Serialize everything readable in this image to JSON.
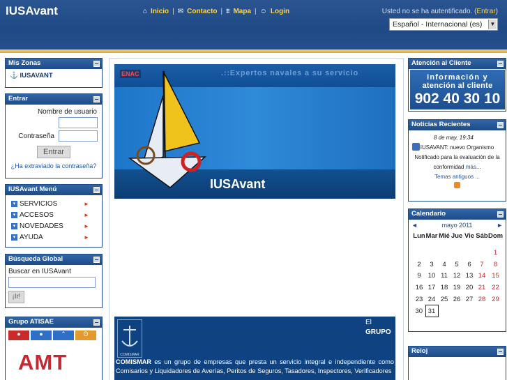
{
  "header": {
    "site_title": "IUSAvant",
    "nav": [
      {
        "icon": "home-icon",
        "label": "Inicio"
      },
      {
        "icon": "mail-icon",
        "label": "Contacto"
      },
      {
        "icon": "sitemap-icon",
        "label": "Mapa"
      },
      {
        "icon": "users-icon",
        "label": "Login"
      }
    ],
    "auth_text": "Usted no se ha autentificado. (",
    "auth_link": "Entrar",
    "auth_close": ")",
    "language": "Español - Internacional (es)"
  },
  "zonas": {
    "title": "Mis Zonas",
    "item": "IUSAVANT"
  },
  "login": {
    "title": "Entrar",
    "username_label": "Nombre de usuario",
    "password_label": "Contraseña",
    "submit": "Entrar",
    "forgot": "¿Ha extraviado la contraseña?"
  },
  "menu": {
    "title": "IUSAvant Menú",
    "items": [
      "SERVICIOS",
      "ACCESOS",
      "NOVEDADES",
      "AYUDA"
    ]
  },
  "search": {
    "title": "Búsqueda Global",
    "label": "Buscar en IUSAvant",
    "button": "¡Ir!"
  },
  "atisae": {
    "title": "Grupo ATISAE",
    "logo_text": "AMT"
  },
  "banner": {
    "enac": "ENAC",
    "slogan": ".::Expertos navales a su servicio",
    "brand": "IUSAvant"
  },
  "comismar": {
    "el": "El",
    "grupo": "GRUPO",
    "logo_text": "COMISMAR",
    "desc_bold": "COMISMAR",
    "desc": " es un grupo de empresas que presta un servicio integral e independiente como Comisarios y Liquidadores de Averías, Peritos de Seguros, Tasadores, Inspectores, Verificadores"
  },
  "atencion": {
    "title": "Atención al Cliente",
    "line1": "Información y",
    "line2": "atención al cliente",
    "phone": "902 40 30 10"
  },
  "noticias": {
    "title": "Noticias Recientes",
    "date": "8 de may, 19:34",
    "text": "IUSAVANT: nuevo Organismo Notificado para la evaluación de la conformidad",
    "more": "más...",
    "older": "Temas antiguos ..."
  },
  "calendar": {
    "title": "Calendario",
    "month": "mayo 2011",
    "prev": "◄",
    "next": "►",
    "days": [
      "Lun",
      "Mar",
      "Mié",
      "Jue",
      "Vie",
      "Sáb",
      "Dom"
    ],
    "weeks": [
      [
        "",
        "",
        "",
        "",
        "",
        "",
        "1"
      ],
      [
        "2",
        "3",
        "4",
        "5",
        "6",
        "7",
        "8"
      ],
      [
        "9",
        "10",
        "11",
        "12",
        "13",
        "14",
        "15"
      ],
      [
        "16",
        "17",
        "18",
        "19",
        "20",
        "21",
        "22"
      ],
      [
        "23",
        "24",
        "25",
        "26",
        "27",
        "28",
        "29"
      ],
      [
        "30",
        "31",
        "",
        "",
        "",
        "",
        ""
      ]
    ],
    "today": "31"
  },
  "reloj": {
    "title": "Reloj"
  },
  "colors": {
    "header_blue": "#1f4a86",
    "accent_gold": "#ffd34a",
    "weekend_red": "#c0282c"
  }
}
